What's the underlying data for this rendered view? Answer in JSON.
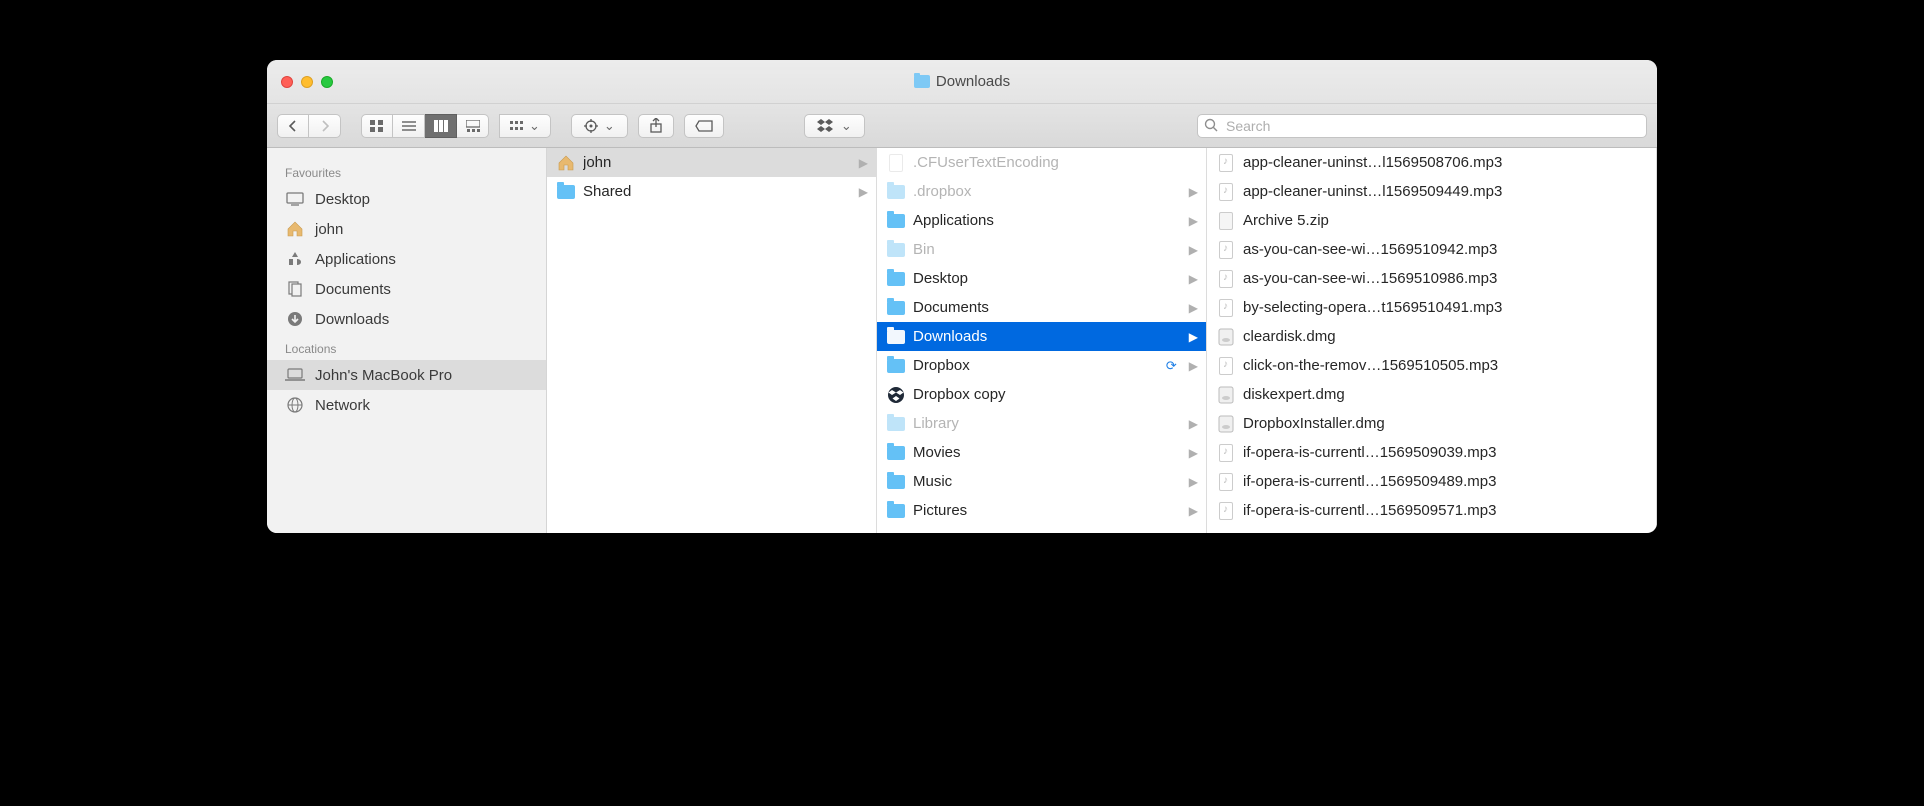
{
  "window": {
    "title": "Downloads"
  },
  "toolbar": {
    "search_placeholder": "Search"
  },
  "sidebar": {
    "favourites_label": "Favourites",
    "locations_label": "Locations",
    "favourites": [
      {
        "label": "Desktop",
        "icon": "desktop"
      },
      {
        "label": "john",
        "icon": "home"
      },
      {
        "label": "Applications",
        "icon": "apps"
      },
      {
        "label": "Documents",
        "icon": "documents"
      },
      {
        "label": "Downloads",
        "icon": "downloads"
      }
    ],
    "locations": [
      {
        "label": "John's MacBook Pro",
        "icon": "laptop",
        "selected": true
      },
      {
        "label": "Network",
        "icon": "network"
      }
    ]
  },
  "col1": [
    {
      "label": "john",
      "icon": "home",
      "arrow": true,
      "selected": true
    },
    {
      "label": "Shared",
      "icon": "folder",
      "arrow": true
    }
  ],
  "col2": [
    {
      "label": ".CFUserTextEncoding",
      "icon": "file-faded",
      "dim": true
    },
    {
      "label": ".dropbox",
      "icon": "folder-faded",
      "dim": true,
      "arrow": true
    },
    {
      "label": "Applications",
      "icon": "folder",
      "arrow": true
    },
    {
      "label": "Bin",
      "icon": "folder-faded",
      "dim": true,
      "arrow": true
    },
    {
      "label": "Desktop",
      "icon": "folder",
      "arrow": true
    },
    {
      "label": "Documents",
      "icon": "folder",
      "arrow": true
    },
    {
      "label": "Downloads",
      "icon": "folder",
      "arrow": true,
      "selected": true
    },
    {
      "label": "Dropbox",
      "icon": "dropbox-folder",
      "arrow": true,
      "sync": true
    },
    {
      "label": "Dropbox copy",
      "icon": "dropbox"
    },
    {
      "label": "Library",
      "icon": "folder-faded",
      "dim": true,
      "arrow": true
    },
    {
      "label": "Movies",
      "icon": "folder",
      "arrow": true
    },
    {
      "label": "Music",
      "icon": "folder",
      "arrow": true
    },
    {
      "label": "Pictures",
      "icon": "folder",
      "arrow": true
    }
  ],
  "col3": [
    {
      "label": "app-cleaner-uninst…l1569508706.mp3",
      "icon": "music"
    },
    {
      "label": "app-cleaner-uninst…l1569509449.mp3",
      "icon": "music"
    },
    {
      "label": "Archive 5.zip",
      "icon": "zip"
    },
    {
      "label": "as-you-can-see-wi…1569510942.mp3",
      "icon": "music"
    },
    {
      "label": "as-you-can-see-wi…1569510986.mp3",
      "icon": "music"
    },
    {
      "label": "by-selecting-opera…t1569510491.mp3",
      "icon": "music"
    },
    {
      "label": "cleardisk.dmg",
      "icon": "dmg"
    },
    {
      "label": "click-on-the-remov…1569510505.mp3",
      "icon": "music"
    },
    {
      "label": "diskexpert.dmg",
      "icon": "dmg"
    },
    {
      "label": "DropboxInstaller.dmg",
      "icon": "dmg"
    },
    {
      "label": "if-opera-is-currentl…1569509039.mp3",
      "icon": "music"
    },
    {
      "label": "if-opera-is-currentl…1569509489.mp3",
      "icon": "music"
    },
    {
      "label": "if-opera-is-currentl…1569509571.mp3",
      "icon": "music"
    }
  ]
}
